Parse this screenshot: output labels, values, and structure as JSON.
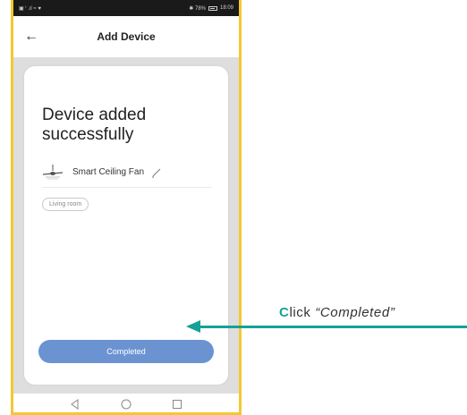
{
  "status_bar": {
    "left_text": "▣ ⁱ .ıl ≈ ♥",
    "right_text": "✱ 78%",
    "time": "18:09"
  },
  "header": {
    "title": "Add Device"
  },
  "card": {
    "success_title": "Device added successfully",
    "device_name": "Smart Ceiling Fan",
    "room_chip": "Living room",
    "completed_label": "Completed"
  },
  "annotation": {
    "first_letter": "C",
    "rest_text": "lick ",
    "quoted_text": "“Completed”"
  },
  "icons": {
    "back": "arrow-left-icon",
    "device": "ceiling-fan-icon",
    "edit": "pencil-icon",
    "nav": [
      "back-triangle-icon",
      "home-circle-icon",
      "recent-square-icon"
    ]
  },
  "colors": {
    "accent_teal": "#16a196",
    "button_blue": "#6b93d2",
    "phone_frame": "#f2c832"
  }
}
